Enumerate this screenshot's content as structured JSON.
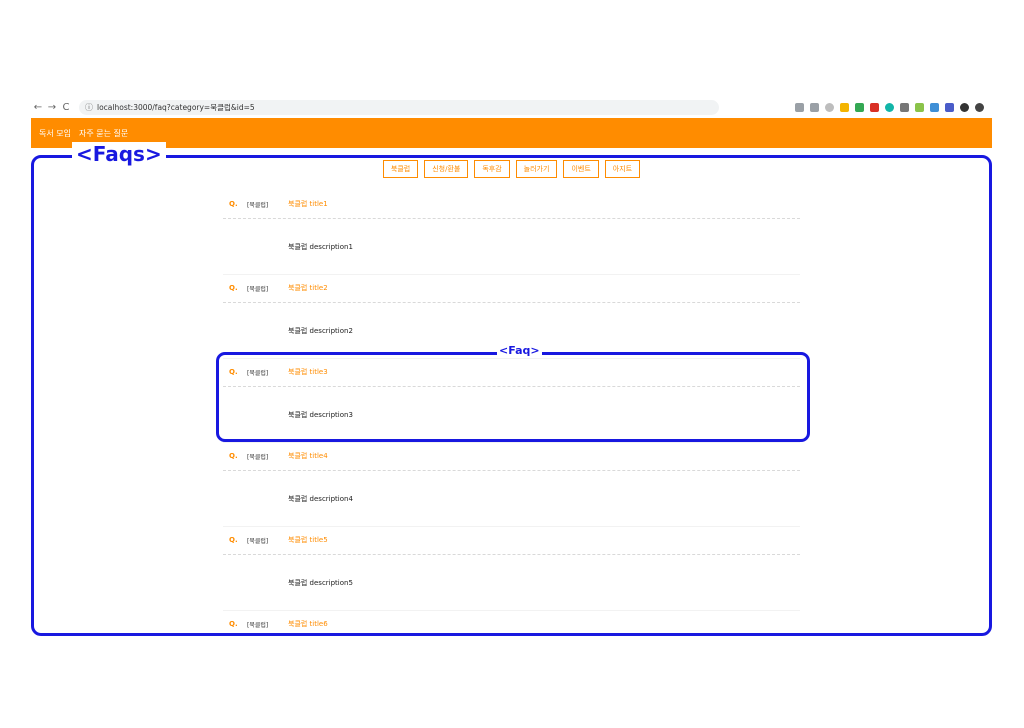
{
  "browser": {
    "back": "←",
    "forward": "→",
    "reload": "C",
    "info_icon": "ⓘ",
    "url": "localhost:3000/faq?category=북클럽&id=5"
  },
  "header": {
    "title": "독서 모임",
    "nav_faq": "자주 묻는 질문"
  },
  "tabs": [
    "북클럽",
    "신청/환불",
    "독후감",
    "놀러가기",
    "이벤트",
    "아지트"
  ],
  "faqs": [
    {
      "q": "Q.",
      "category": "[북클럽]",
      "title": "북클럽 title1",
      "description": "북클럽 description1"
    },
    {
      "q": "Q.",
      "category": "[북클럽]",
      "title": "북클럽 title2",
      "description": "북클럽 description2"
    },
    {
      "q": "Q.",
      "category": "[북클럽]",
      "title": "북클럽 title3",
      "description": "북클럽 description3"
    },
    {
      "q": "Q.",
      "category": "[북클럽]",
      "title": "북클럽 title4",
      "description": "북클럽 description4"
    },
    {
      "q": "Q.",
      "category": "[북클럽]",
      "title": "북클럽 title5",
      "description": "북클럽 description5"
    },
    {
      "q": "Q.",
      "category": "[북클럽]",
      "title": "북클럽 title6",
      "description": ""
    }
  ],
  "annotations": {
    "faqs_label": "<Faqs>",
    "faq_label": "<Faq>"
  },
  "colors": {
    "accent": "#ff8c00",
    "annotation": "#1818e0"
  }
}
